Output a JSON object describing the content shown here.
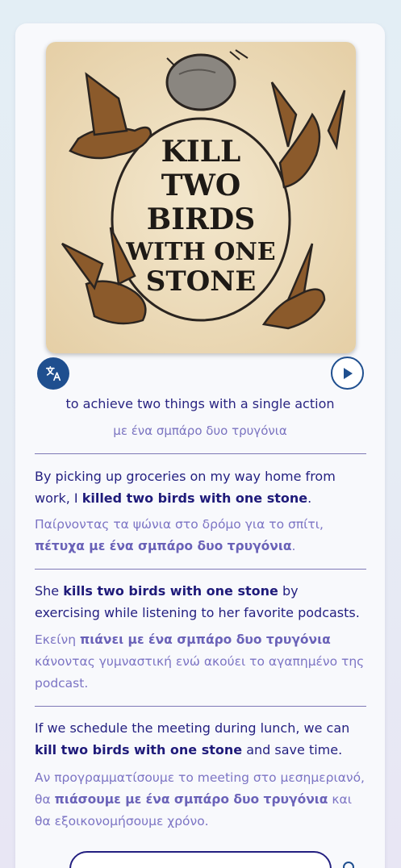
{
  "illustration": {
    "title_lines": [
      "KILL",
      "TWO",
      "BIRDS",
      "WITH ONE",
      "STONE"
    ]
  },
  "buttons": {
    "translate_icon": "translate-icon",
    "play_icon": "play-icon"
  },
  "meaning": {
    "en": "to achieve two things with a single action",
    "gr": "με ένα σμπάρο δυο τρυγόνια"
  },
  "examples": [
    {
      "en": [
        "By picking up groceries on my way home from work, I ",
        "killed two birds with one stone",
        "."
      ],
      "gr": [
        "Παίρνοντας τα ψώνια στο δρόμο για το σπίτι, ",
        "πέτυχα με ένα σμπάρο δυο τρυγόνια",
        "."
      ]
    },
    {
      "en": [
        "She ",
        "kills two birds with one stone",
        " by exercising while listening to her favorite podcasts."
      ],
      "gr": [
        "Εκείνη ",
        "πιάνει με ένα σμπάρο δυο τρυγόνια",
        " κάνοντας γυμναστική ενώ ακούει το αγαπημένο της podcast."
      ]
    },
    {
      "en": [
        "If we schedule the meeting during lunch, we can ",
        "kill two birds with one stone",
        " and save time."
      ],
      "gr": [
        "Αν προγραμματίσουμε το meeting στο μεσημεριανό, θα ",
        "πιάσουμε με ένα σμπάρο δυο τρυγόνια",
        " και θα εξοικονομήσουμε χρόνο."
      ]
    }
  ],
  "colors": {
    "primary": "#1f4f8f",
    "text": "#231f80",
    "translation": "#7c74c4"
  }
}
